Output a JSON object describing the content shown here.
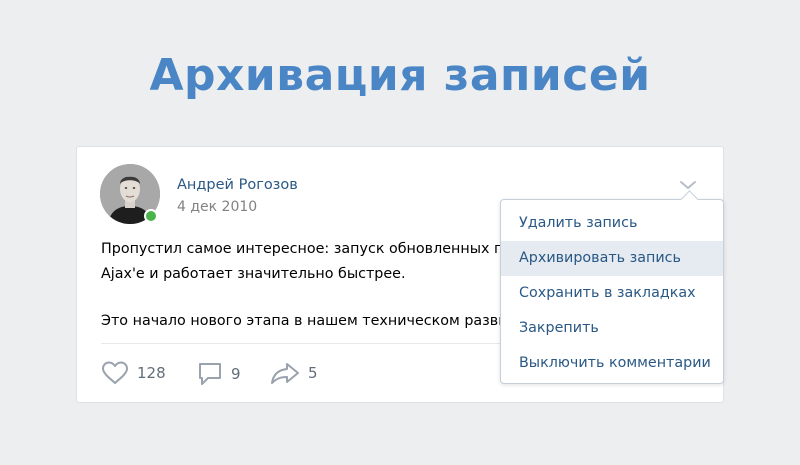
{
  "headline": "Архивация записей",
  "post": {
    "author": "Андрей Рогозов",
    "date": "4 дек 2010",
    "lines": [
      "Пропустил самое интересное: запуск обновленных п",
      "Ajax'е и работает значительно быстрее.",
      "",
      "Это начало нового этапа в нашем техническом разви"
    ],
    "likes": "128",
    "comments": "9",
    "shares": "5",
    "avatar_online": true
  },
  "menu": {
    "items": [
      {
        "label": "Удалить запись",
        "active": false
      },
      {
        "label": "Архивировать запись",
        "active": true
      },
      {
        "label": "Сохранить в закладках",
        "active": false
      },
      {
        "label": "Закрепить",
        "active": false
      },
      {
        "label": "Выключить комментарии",
        "active": false
      }
    ]
  },
  "icons": {
    "like": "heart-icon",
    "comment": "comment-icon",
    "share": "share-icon",
    "menu": "chevron-down-icon"
  },
  "colors": {
    "headline": "#4a86c5",
    "link": "#2a5885",
    "online": "#4bb34b",
    "active_item_bg": "#e5ebf1",
    "background": "#edeef0"
  }
}
